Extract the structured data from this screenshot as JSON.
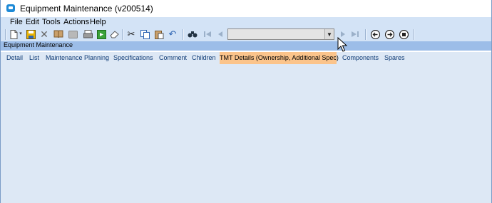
{
  "window": {
    "title": "Equipment Maintenance (v200514)"
  },
  "menu": {
    "items": [
      "File",
      "Edit",
      "Tools",
      "Actions",
      "Help"
    ]
  },
  "toolbar": {
    "icons": [
      "new-icon",
      "new-dropdown-icon",
      "save-icon",
      "delete-icon",
      "open-book-icon",
      "blank-icon",
      "print-icon",
      "copy-record-icon",
      "refresh-icon",
      "eraser-icon",
      "cut-icon",
      "copy-icon",
      "paste-icon",
      "undo-icon",
      "find-icon",
      "first-record-icon",
      "previous-record-icon",
      "next-record-icon",
      "last-record-icon",
      "back-icon",
      "forward-icon",
      "stop-icon"
    ],
    "record_selector_value": ""
  },
  "form": {
    "title": "Equipment Maintenance"
  },
  "tabs": [
    {
      "label": "Detail",
      "active": false
    },
    {
      "label": "List",
      "active": false
    },
    {
      "label": "Maintenance Planning",
      "active": false
    },
    {
      "label": "Specifications",
      "active": false
    },
    {
      "label": "Comment",
      "active": false
    },
    {
      "label": "Children",
      "active": false
    },
    {
      "label": "TMT Details (Ownership, Additional Spec)",
      "active": true
    },
    {
      "label": "Components",
      "active": false
    },
    {
      "label": "Spares",
      "active": false
    }
  ],
  "colors": {
    "titlebar_bg": "#ffffff",
    "menubar_bg": "#d3e3f6",
    "form_header_bg": "#9cbde8",
    "tab_active_bg": "#fbc48b",
    "tab_text": "#0f3b75",
    "content_bg": "#dde8f5"
  }
}
